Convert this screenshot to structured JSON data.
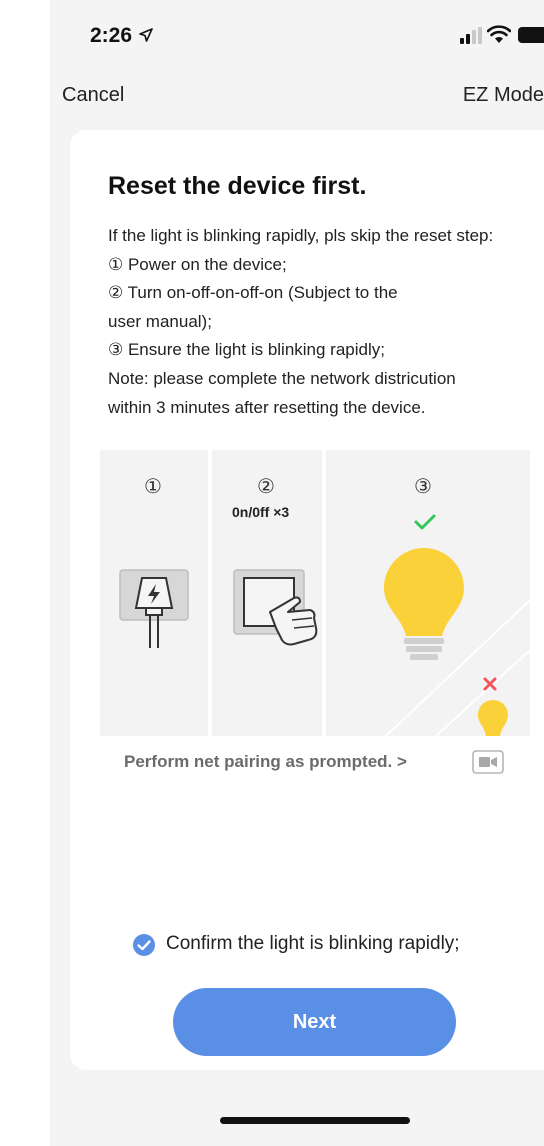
{
  "status_bar": {
    "time": "2:26"
  },
  "nav": {
    "cancel_label": "Cancel",
    "mode_label": "EZ Mode"
  },
  "card": {
    "title": "Reset the device first.",
    "instructions": [
      "If the light is blinking rapidly, pls skip the reset step:",
      "① Power on the device;",
      "② Turn on-off-on-off-on (Subject to the",
      "user manual);",
      "③ Ensure the light is blinking rapidly;",
      "Note: please complete the network districution",
      "within 3 minutes after resetting the device."
    ],
    "steps": [
      {
        "number": "①",
        "label": ""
      },
      {
        "number": "②",
        "label": "0n/0ff ×3"
      },
      {
        "number": "③",
        "label": ""
      }
    ],
    "help_link": "Perform net pairing as prompted. >",
    "confirm_text": "Confirm the light is blinking rapidly;",
    "confirm_checked": true,
    "next_label": "Next"
  },
  "colors": {
    "accent": "#5a8fe6",
    "bulb": "#fbd13a",
    "check_green": "#34c759",
    "cross_red": "#f0595c"
  },
  "icons": [
    "location-arrow-icon",
    "signal-icon",
    "wifi-icon",
    "battery-icon",
    "power-plug-icon",
    "switch-hand-icon",
    "check-icon",
    "bulb-icon",
    "cross-icon",
    "video-icon",
    "checkbox-icon"
  ]
}
